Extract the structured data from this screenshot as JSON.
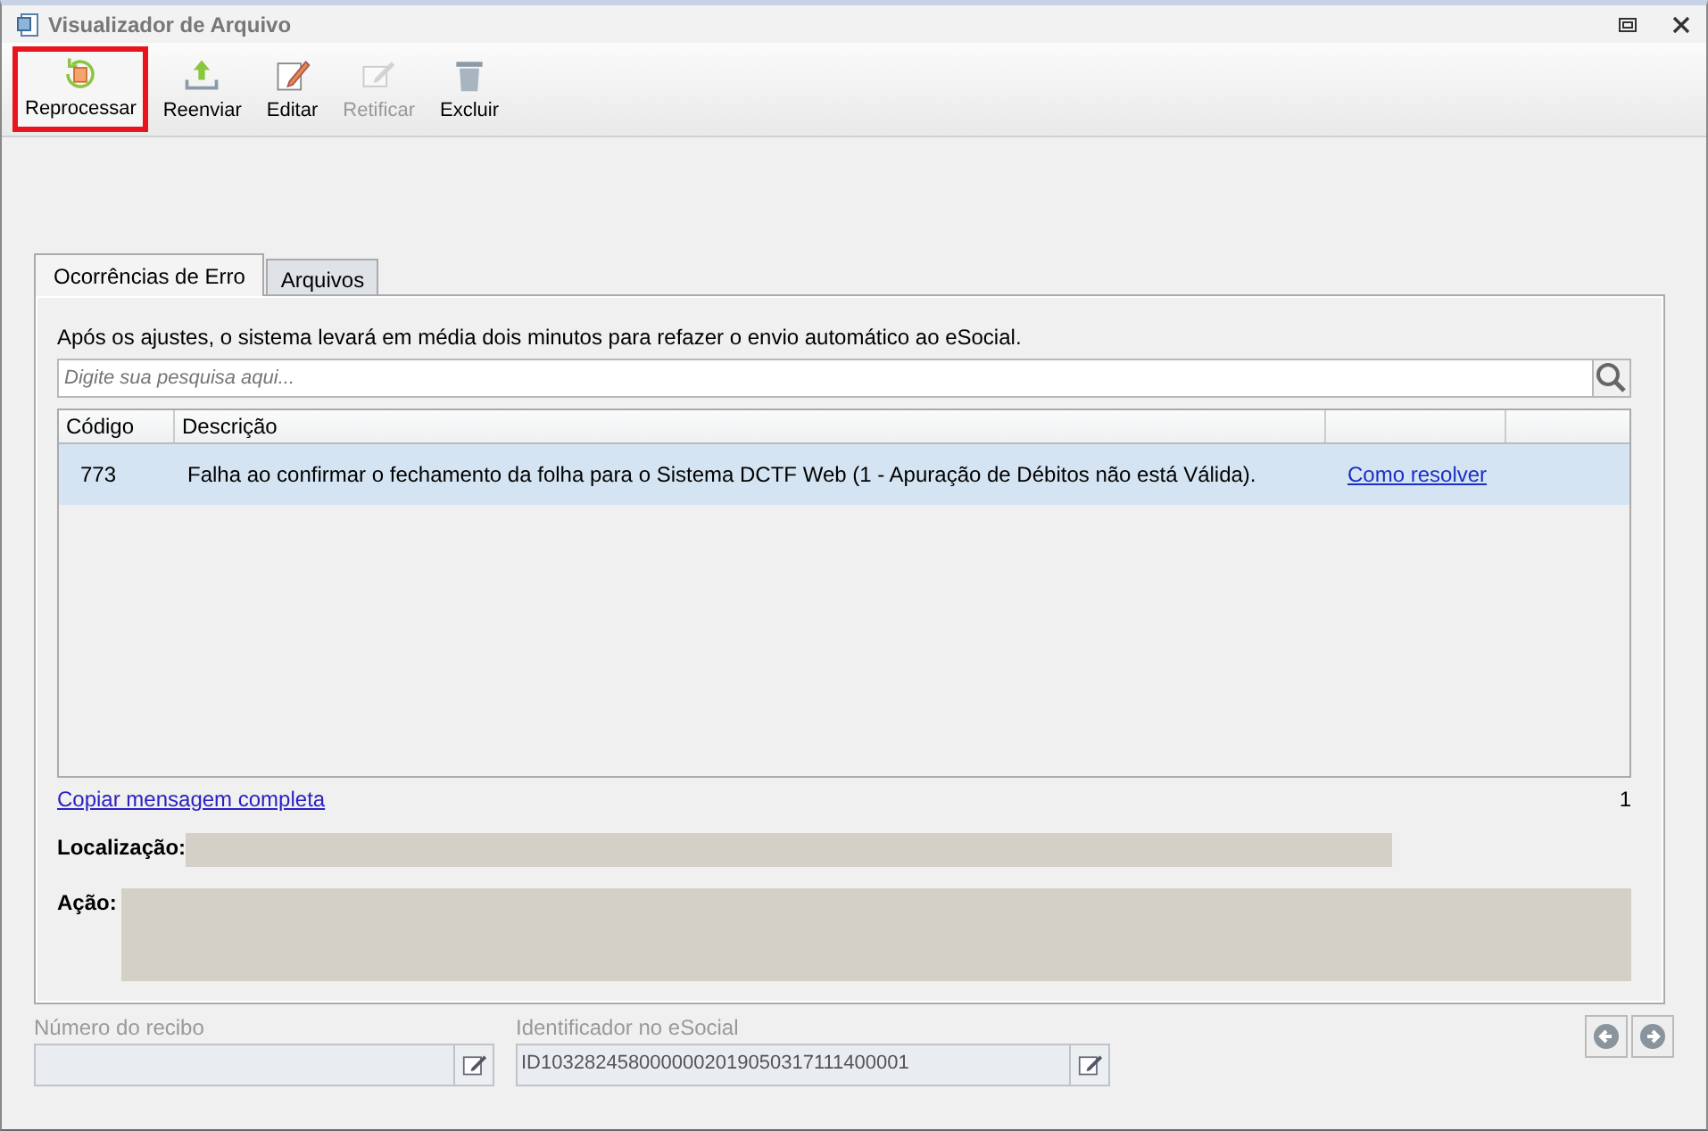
{
  "window": {
    "title": "Visualizador de Arquivo"
  },
  "toolbar": [
    {
      "label": "Reprocessar",
      "kind": "reprocess",
      "disabled": false,
      "highlighted": true
    },
    {
      "label": "Reenviar",
      "kind": "upload",
      "disabled": false,
      "highlighted": false
    },
    {
      "label": "Editar",
      "kind": "edit",
      "disabled": false,
      "highlighted": false
    },
    {
      "label": "Retificar",
      "kind": "rectify",
      "disabled": true,
      "highlighted": false
    },
    {
      "label": "Excluir",
      "kind": "delete",
      "disabled": false,
      "highlighted": false
    }
  ],
  "tabs": [
    {
      "label": "Ocorrências de Erro",
      "selected": true
    },
    {
      "label": "Arquivos",
      "selected": false
    }
  ],
  "notice": "Após os ajustes, o sistema levará em média dois minutos para refazer o envio automático ao eSocial.",
  "search": {
    "placeholder": "Digite sua pesquisa aqui..."
  },
  "table": {
    "columns": [
      "Código",
      "Descrição"
    ],
    "rows": [
      {
        "code": "773",
        "description": "Falha ao confirmar o fechamento da folha para o Sistema DCTF Web (1 - Apuração de Débitos não está Válida).",
        "link": "Como resolver",
        "selected": true
      }
    ]
  },
  "copy_link": "Copiar mensagem completa",
  "count": "1",
  "details": [
    {
      "label": "Localização:"
    },
    {
      "label": "Ação:"
    }
  ],
  "fields": [
    {
      "label": "Número do recibo"
    },
    {
      "label": "Identificador no eSocial",
      "value": "ID1032824580000002019050317111400001"
    }
  ]
}
